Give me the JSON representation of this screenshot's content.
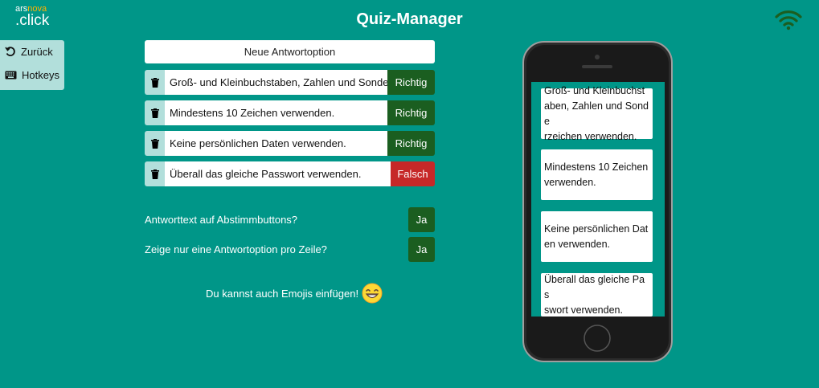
{
  "brand": {
    "line1_a": "ars",
    "line1_b": "nova",
    "line2": ".click"
  },
  "header": {
    "title": "Quiz-Manager",
    "status_icon": "wifi-icon"
  },
  "sidebar": {
    "items": [
      {
        "label": "Zurück",
        "icon": "back-arrow-icon"
      },
      {
        "label": "Hotkeys",
        "icon": "keyboard-icon"
      }
    ]
  },
  "editor": {
    "add_label": "Neue Antwortoption",
    "answers": [
      {
        "text": "Groß- und Kleinbuchstaben, Zahlen und Sonder:",
        "status": "Richtig"
      },
      {
        "text": "Mindestens 10 Zeichen verwenden.",
        "status": "Richtig"
      },
      {
        "text": "Keine persönlichen Daten verwenden.",
        "status": "Richtig"
      },
      {
        "text": "Überall das gleiche Passwort verwenden.",
        "status": "Falsch"
      }
    ]
  },
  "options": [
    {
      "label": "Antworttext auf Abstimmbuttons?",
      "value": "Ja"
    },
    {
      "label": "Zeige nur eine Antwortoption pro Zeile?",
      "value": "Ja"
    }
  ],
  "emoji_hint": "Du kannst auch Emojis einfügen!",
  "preview": {
    "cards": [
      [
        "Groß- und Kleinbuchst",
        "aben, Zahlen und Sonde",
        "rzeichen verwenden."
      ],
      [
        "Mindestens 10 Zeichen",
        "verwenden."
      ],
      [
        "Keine persönlichen Dat",
        "en verwenden."
      ],
      [
        "Überall das gleiche Pas",
        "swort verwenden."
      ]
    ]
  },
  "colors": {
    "background": "#009688",
    "correct": "#1b5e20",
    "wrong": "#c62828",
    "sidebar": "#b2dfdb",
    "brand_accent": "#ffb300"
  }
}
